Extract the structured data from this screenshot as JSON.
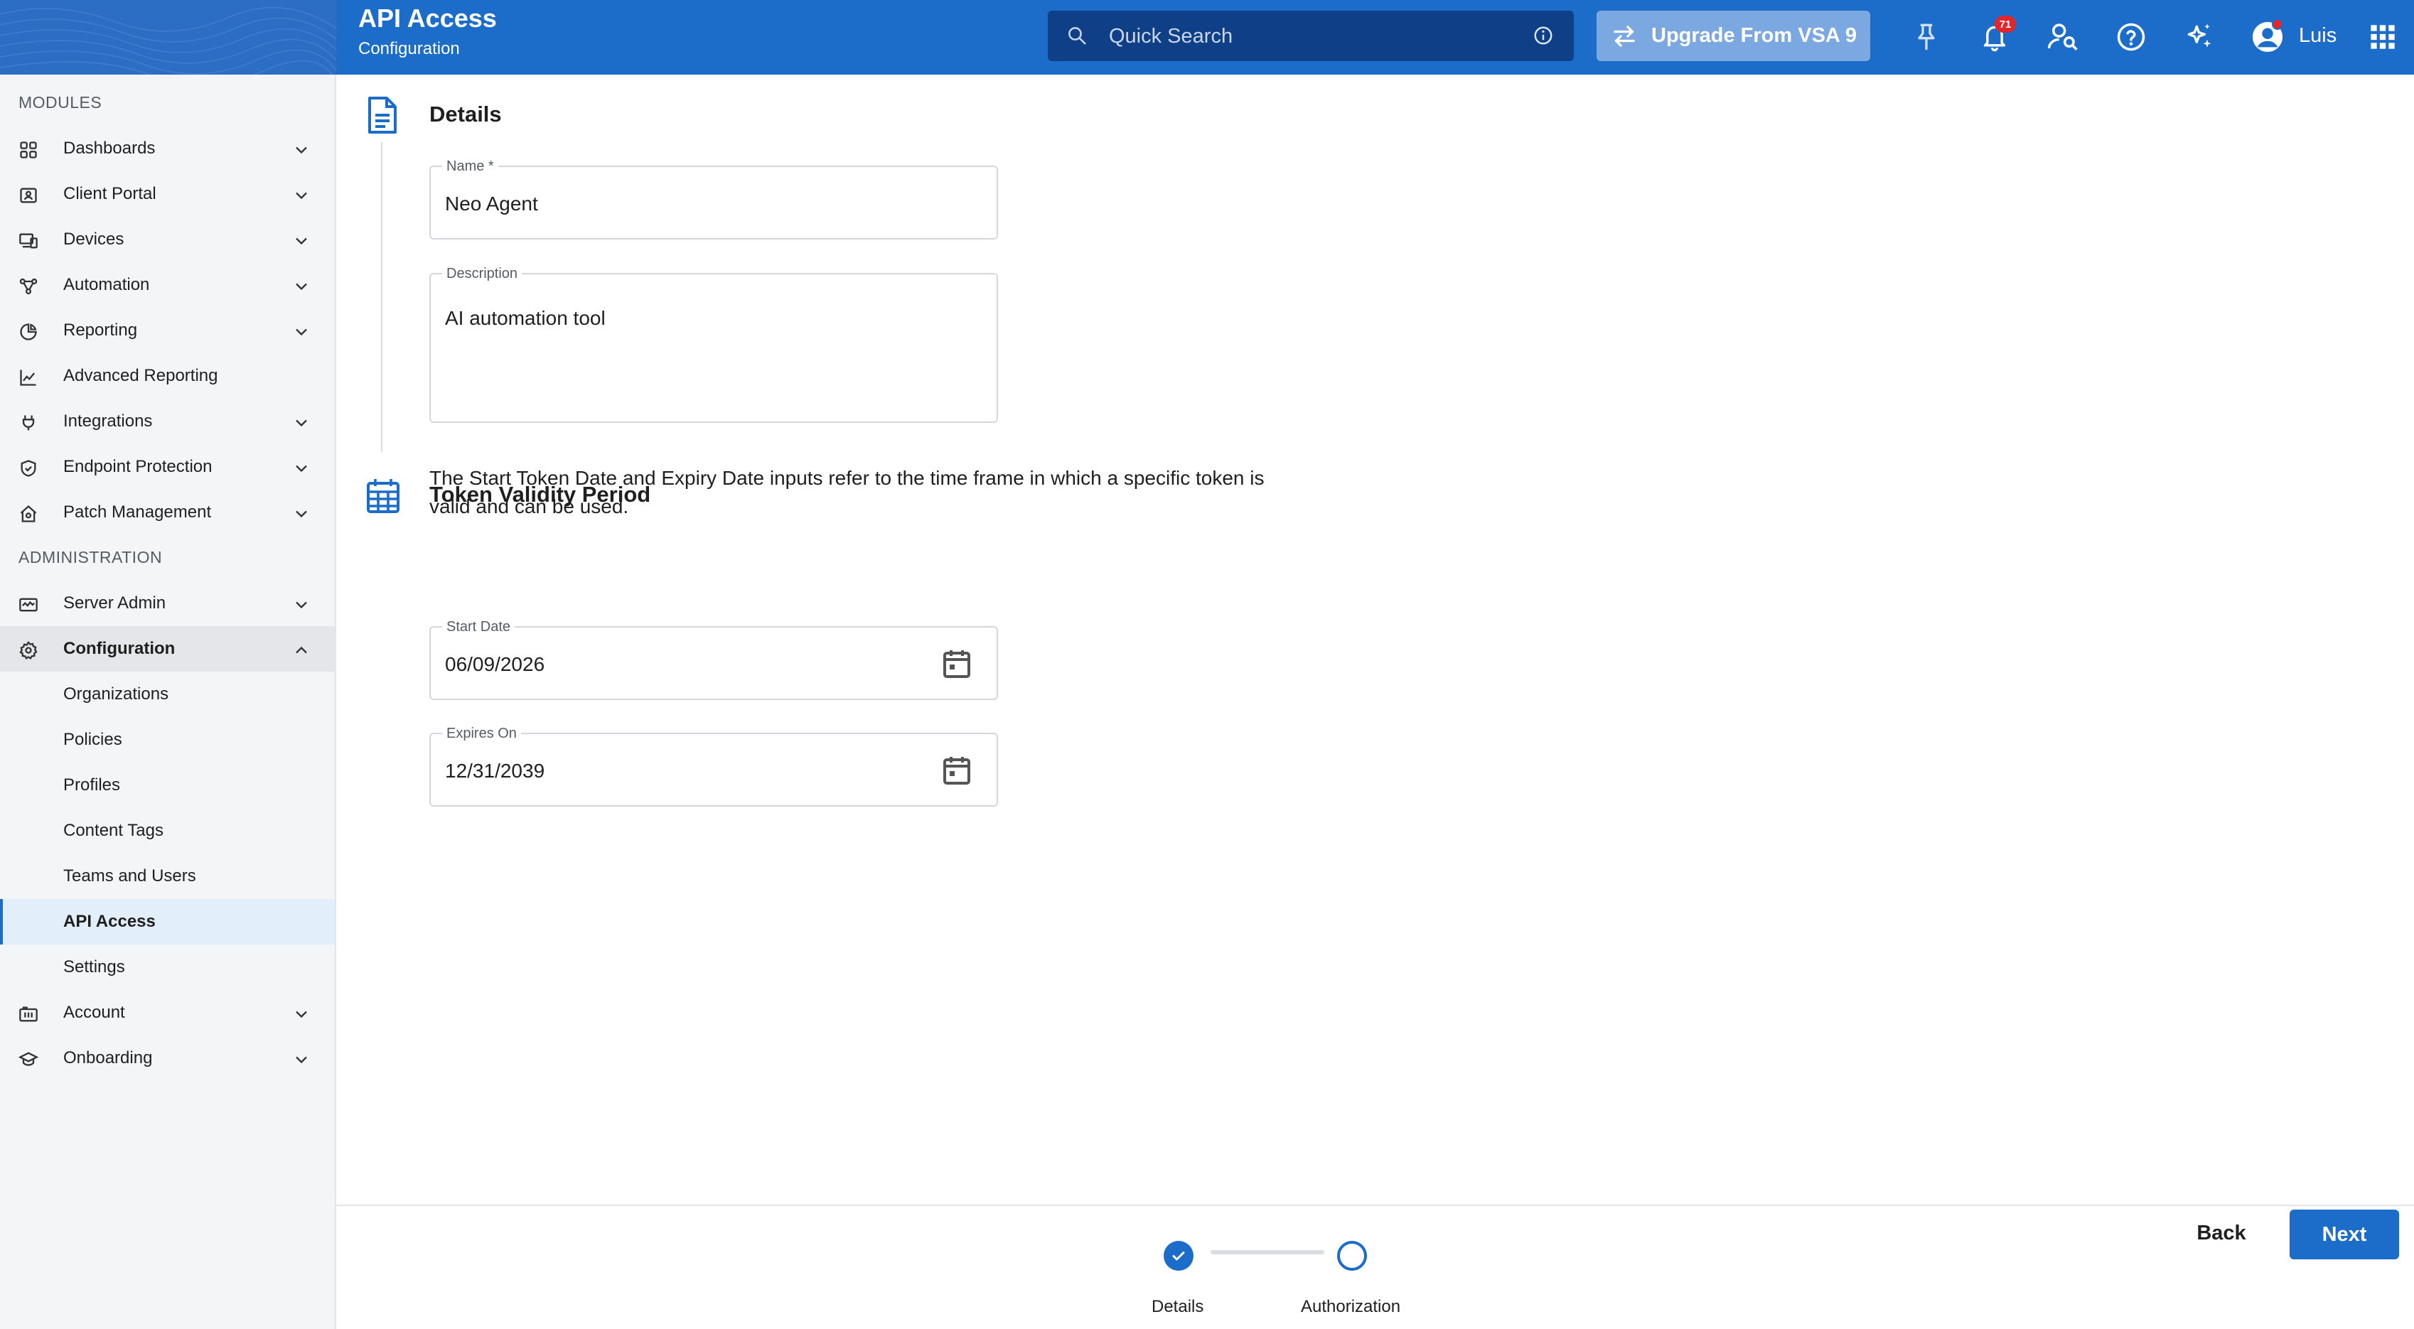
{
  "header": {
    "title": "API Access",
    "subtitle": "Configuration",
    "search_placeholder": "Quick Search",
    "upgrade_label": "Upgrade From VSA 9",
    "notification_count": "71",
    "user_name": "Luis"
  },
  "sidebar": {
    "modules_label": "MODULES",
    "admin_label": "ADMINISTRATION",
    "modules": [
      {
        "label": "Dashboards",
        "icon": "grid-icon"
      },
      {
        "label": "Client Portal",
        "icon": "portal-icon"
      },
      {
        "label": "Devices",
        "icon": "devices-icon"
      },
      {
        "label": "Automation",
        "icon": "automation-icon"
      },
      {
        "label": "Reporting",
        "icon": "reporting-icon"
      },
      {
        "label": "Advanced Reporting",
        "icon": "chart-icon"
      },
      {
        "label": "Integrations",
        "icon": "plug-icon"
      },
      {
        "label": "Endpoint Protection",
        "icon": "shield-icon"
      },
      {
        "label": "Patch Management",
        "icon": "patch-icon"
      }
    ],
    "admin": [
      {
        "label": "Server Admin",
        "icon": "server-icon"
      },
      {
        "label": "Configuration",
        "icon": "gear-icon"
      }
    ],
    "config_children": [
      {
        "label": "Organizations"
      },
      {
        "label": "Policies"
      },
      {
        "label": "Profiles"
      },
      {
        "label": "Content Tags"
      },
      {
        "label": "Teams and Users"
      },
      {
        "label": "API Access"
      },
      {
        "label": "Settings"
      }
    ],
    "bottom": [
      {
        "label": "Account",
        "icon": "account-icon"
      },
      {
        "label": "Onboarding",
        "icon": "onboarding-icon"
      }
    ]
  },
  "details": {
    "title": "Details",
    "name_label": "Name *",
    "name_value": "Neo Agent",
    "description_label": "Description",
    "description_value": "AI automation tool"
  },
  "token": {
    "title": "Token Validity Period",
    "description": "The Start Token Date and Expiry Date inputs refer to the time frame in which a specific token is valid and can be used.",
    "start_label": "Start Date",
    "start_value": "06/09/2026",
    "expires_label": "Expires On",
    "expires_value": "12/31/2039"
  },
  "footer": {
    "step1": "Details",
    "step2": "Authorization",
    "back": "Back",
    "next": "Next"
  },
  "colors": {
    "primary": "#1c6dc9",
    "search_bg": "#0f3f86",
    "upgrade_bg": "#7ba8e0",
    "badge": "#e3262b"
  }
}
